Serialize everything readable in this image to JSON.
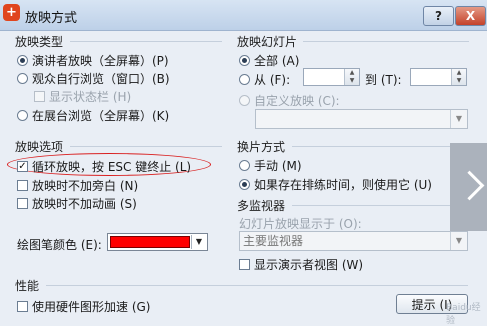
{
  "window": {
    "icon_glyph": "+",
    "title": "放映方式",
    "help_label": "?",
    "close_label": "X"
  },
  "show_type": {
    "title": "放映类型",
    "options": [
      {
        "label": "演讲者放映（全屏幕）(P)",
        "checked": true
      },
      {
        "label": "观众自行浏览（窗口）(B)",
        "checked": false
      },
      {
        "label": "在展台浏览（全屏幕）(K)",
        "checked": false
      }
    ],
    "show_status_bar": {
      "label": "显示状态栏 (H)",
      "checked": false,
      "disabled": true
    }
  },
  "slides": {
    "title": "放映幻灯片",
    "all_label": "全部 (A)",
    "from_label": "从 (F):",
    "to_label": "到 (T):",
    "from_value": "",
    "to_value": "",
    "custom_label": "自定义放映 (C):",
    "custom_value": ""
  },
  "show_options": {
    "title": "放映选项",
    "loop": {
      "label": "循环放映，按 ESC 键终止 (L)",
      "checked": true
    },
    "no_narration": {
      "label": "放映时不加旁白 (N)",
      "checked": false
    },
    "no_animation": {
      "label": "放映时不加动画 (S)",
      "checked": false
    },
    "pen_color_label": "绘图笔颜色 (E):",
    "pen_color": "#ff0000"
  },
  "advance": {
    "title": "换片方式",
    "manual_label": "手动 (M)",
    "timings_label": "如果存在排练时间，则使用它 (U)"
  },
  "multi_monitor": {
    "title": "多监视器",
    "display_on_label": "幻灯片放映显示于 (O):",
    "monitor_value": "主要监视器",
    "presenter_view": {
      "label": "显示演示者视图 (W)",
      "checked": false
    }
  },
  "performance": {
    "title": "性能",
    "hw_accel": {
      "label": "使用硬件图形加速 (G)",
      "checked": false
    }
  },
  "tips_button": "提示 (I)",
  "watermark": "Baidu经验"
}
